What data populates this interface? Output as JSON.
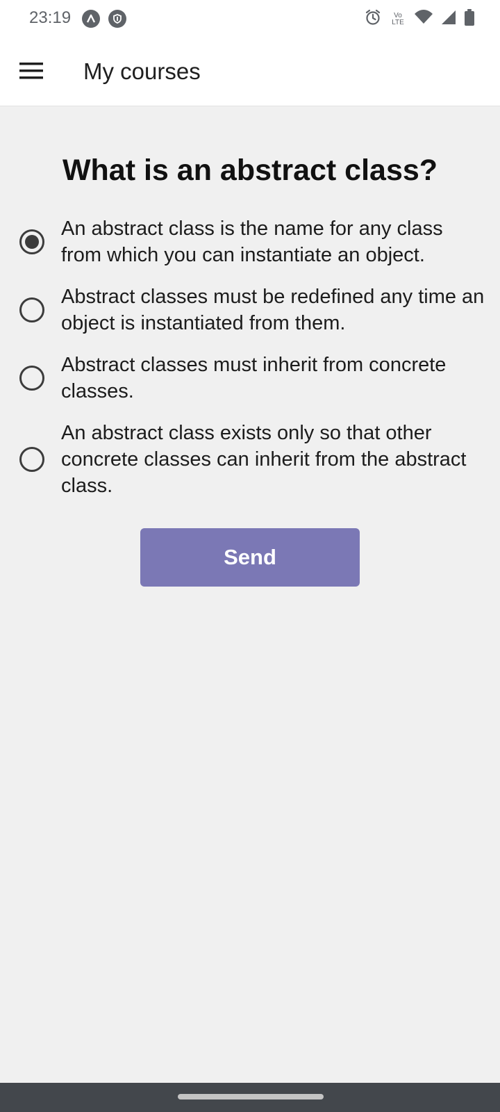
{
  "status_bar": {
    "time": "23:19",
    "left_icons": [
      "a-badge-icon",
      "shield-badge-icon"
    ],
    "right_icons": [
      "alarm-icon",
      "volte-icon",
      "wifi-icon",
      "signal-icon",
      "battery-icon"
    ],
    "volte_top": "Vo",
    "volte_bottom": "LTE"
  },
  "app_bar": {
    "menu_icon": "hamburger-menu-icon",
    "title": "My courses"
  },
  "quiz": {
    "question": "What is an abstract class?",
    "options": [
      {
        "label": "An abstract class is the name for any class from which you can instantiate an object.",
        "selected": true
      },
      {
        "label": "Abstract classes must be redefined any time an object is instantiated from them.",
        "selected": false
      },
      {
        "label": "Abstract classes must inherit from concrete classes.",
        "selected": false
      },
      {
        "label": "An abstract class exists only so that other concrete classes can inherit from the abstract class.",
        "selected": false
      }
    ],
    "send_label": "Send"
  },
  "colors": {
    "send_button": "#7b78b5",
    "background": "#f0f0f0",
    "nav_bar": "#43474c"
  }
}
